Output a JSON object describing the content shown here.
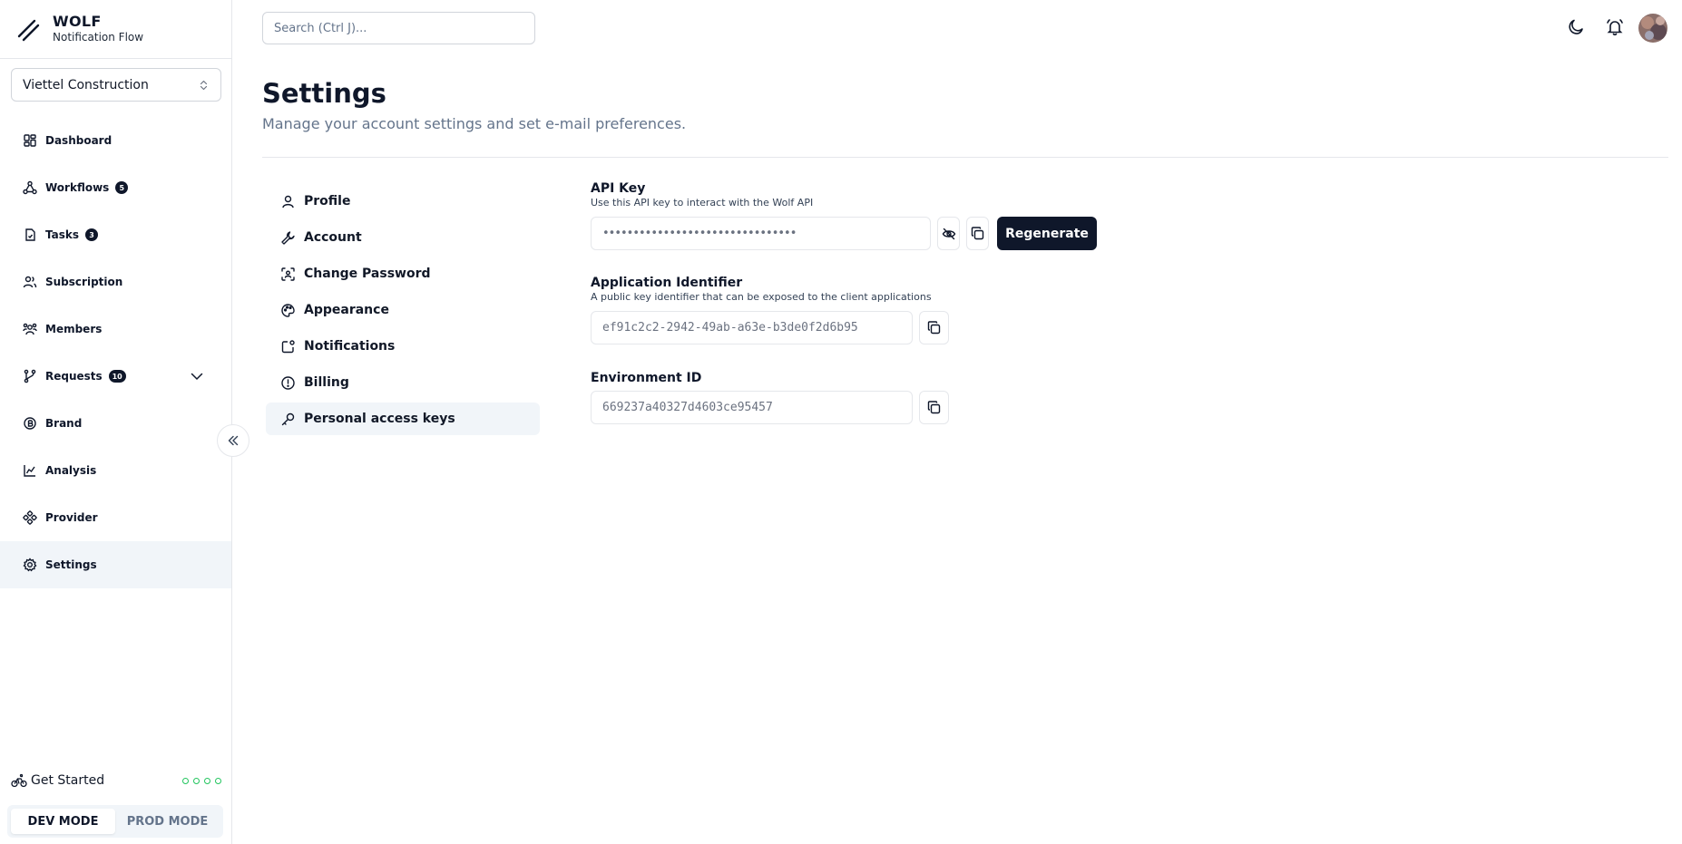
{
  "app": {
    "name": "WOLF",
    "subtitle": "Notification Flow"
  },
  "org_select": {
    "value": "Viettel Construction"
  },
  "sidebar": {
    "items": [
      {
        "label": "Dashboard",
        "icon": "dashboard-icon"
      },
      {
        "label": "Workflows",
        "icon": "workflow-icon",
        "badge": "5"
      },
      {
        "label": "Tasks",
        "icon": "tasks-icon",
        "badge": "3"
      },
      {
        "label": "Subscription",
        "icon": "users-icon"
      },
      {
        "label": "Members",
        "icon": "members-icon"
      },
      {
        "label": "Requests",
        "icon": "requests-icon",
        "badge": "10"
      },
      {
        "label": "Brand",
        "icon": "brand-icon"
      },
      {
        "label": "Analysis",
        "icon": "chart-icon"
      },
      {
        "label": "Provider",
        "icon": "provider-icon"
      },
      {
        "label": "Settings",
        "icon": "gear-icon",
        "active": true
      }
    ],
    "get_started": "Get Started",
    "modes": {
      "dev": "DEV MODE",
      "prod": "PROD MODE",
      "active": "dev"
    }
  },
  "header": {
    "search_placeholder": "Search (Ctrl J)..."
  },
  "page": {
    "title": "Settings",
    "subtitle": "Manage your account settings and set e-mail preferences."
  },
  "settings_nav": [
    {
      "label": "Profile",
      "icon": "user-icon"
    },
    {
      "label": "Account",
      "icon": "wrench-icon"
    },
    {
      "label": "Change Password",
      "icon": "scan-face-icon"
    },
    {
      "label": "Appearance",
      "icon": "palette-icon"
    },
    {
      "label": "Notifications",
      "icon": "notification-icon"
    },
    {
      "label": "Billing",
      "icon": "alert-circle-icon"
    },
    {
      "label": "Personal access keys",
      "icon": "key-icon",
      "active": true
    }
  ],
  "api_key": {
    "label": "API Key",
    "description": "Use this API key to interact with the Wolf API",
    "value": "••••••••••••••••••••••••••••••••",
    "regenerate_label": "Regenerate"
  },
  "app_identifier": {
    "label": "Application Identifier",
    "description": "A public key identifier that can be exposed to the client applications",
    "value": "ef91c2c2-2942-49ab-a63e-b3de0f2d6b95"
  },
  "environment_id": {
    "label": "Environment ID",
    "value": "669237a40327d4603ce95457"
  },
  "colors": {
    "primary": "#0f172a",
    "muted": "#64748b",
    "active_bg": "#f1f5f9",
    "progress_dot": "#22c55e"
  }
}
